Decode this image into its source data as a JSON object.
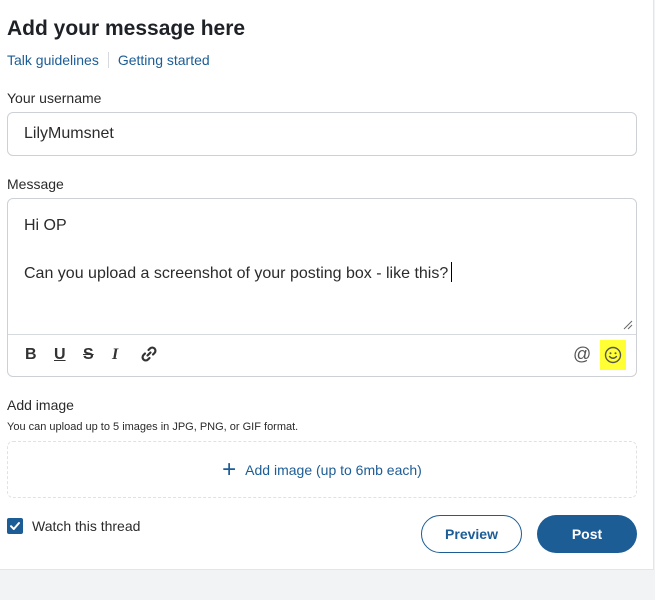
{
  "form": {
    "title": "Add your message here",
    "links": {
      "talk_guidelines": "Talk guidelines",
      "getting_started": "Getting started"
    },
    "username_label": "Your username",
    "username_value": "LilyMumsnet",
    "message_label": "Message",
    "message_lines": [
      "Hi OP",
      "",
      "Can you upload a screenshot of your posting box - like this?"
    ],
    "toolbar": {
      "bold": "B",
      "underline": "U",
      "strikethrough": "S",
      "italic": "I",
      "at": "@",
      "icons": [
        "bold-icon",
        "underline-icon",
        "strikethrough-icon",
        "italic-icon",
        "link-icon",
        "mention-icon",
        "emoji-icon"
      ],
      "highlight_color": "#ffff33"
    },
    "add_image_label": "Add image",
    "add_image_hint": "You can upload up to 5 images in JPG, PNG, or GIF format.",
    "add_image_button": "Add image (up to 6mb each)",
    "watch_thread_label": "Watch this thread",
    "watch_thread_checked": true,
    "preview_label": "Preview",
    "post_label": "Post"
  },
  "colors": {
    "accent": "#1c5d96",
    "text": "#2b2b2b",
    "border": "#cdd1d5"
  }
}
